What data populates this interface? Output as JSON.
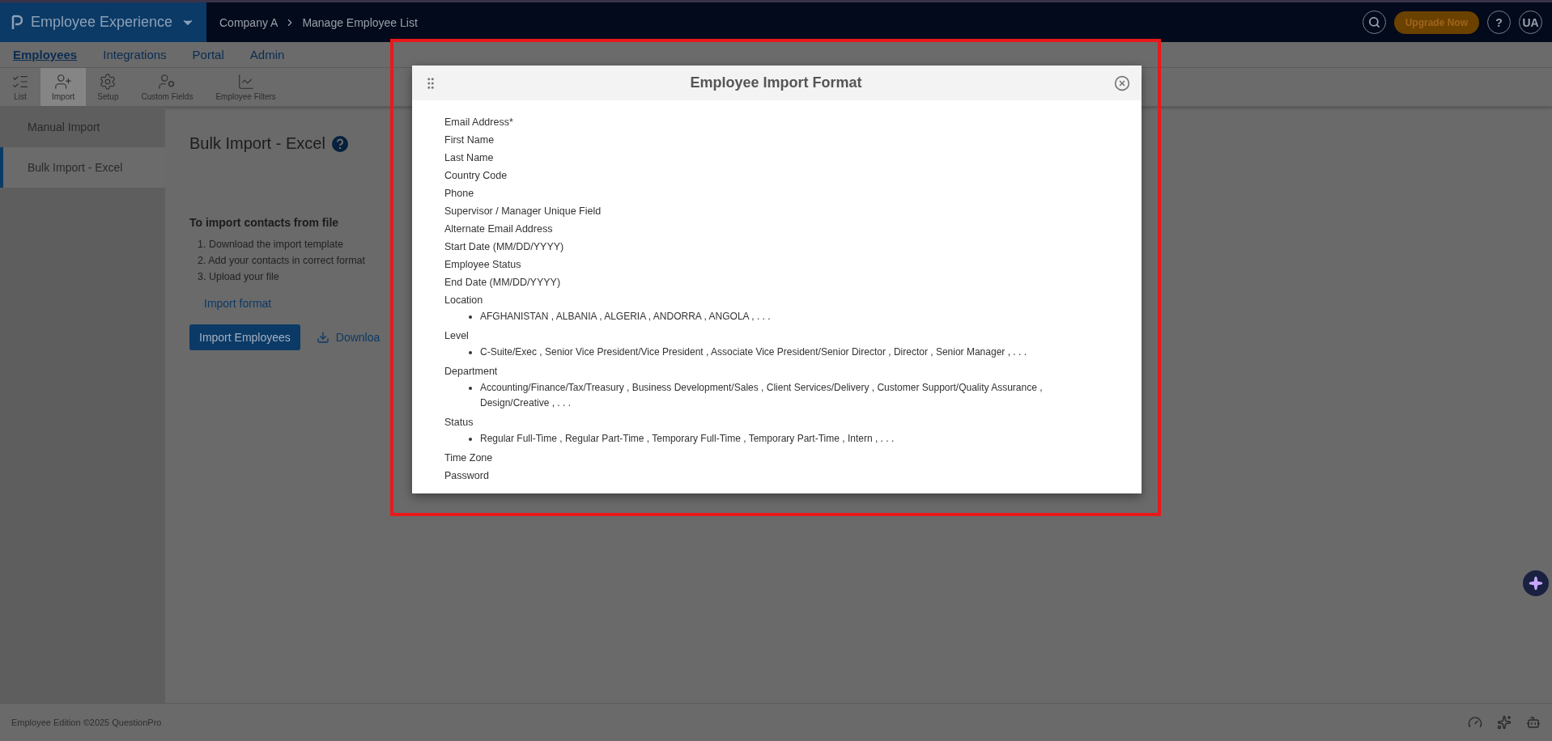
{
  "app": {
    "product": "Employee Experience",
    "breadcrumb": [
      "Company A",
      "Manage Employee List"
    ],
    "upgrade_button": "Upgrade Now",
    "help_button": "?",
    "avatar": "UA"
  },
  "nav_tabs": [
    {
      "label": "Employees",
      "selected": true
    },
    {
      "label": "Integrations",
      "selected": false
    },
    {
      "label": "Portal",
      "selected": false
    },
    {
      "label": "Admin",
      "selected": false
    }
  ],
  "toolbar": [
    {
      "label": "List",
      "kind": "list",
      "selected": false
    },
    {
      "label": "Import",
      "kind": "import",
      "selected": true
    },
    {
      "label": "Setup",
      "kind": "setup",
      "selected": false
    },
    {
      "label": "Custom Fields",
      "kind": "custom",
      "selected": false
    },
    {
      "label": "Employee Filters",
      "kind": "filters",
      "selected": false
    }
  ],
  "sidebar": {
    "items": [
      {
        "label": "Manual Import",
        "selected": false
      },
      {
        "label": "Bulk Import - Excel",
        "selected": true
      }
    ]
  },
  "main": {
    "title": "Bulk Import - Excel",
    "instructions_title": "To import contacts from file",
    "steps": [
      "1. Download the import template",
      "2. Add your contacts in correct format",
      "3. Upload your file"
    ],
    "format_link": "Import format",
    "import_button": "Import Employees",
    "download_link": "Downloa"
  },
  "modal": {
    "title": "Employee Import Format",
    "fields": [
      {
        "label": "Email Address*"
      },
      {
        "label": "First Name"
      },
      {
        "label": "Last Name"
      },
      {
        "label": "Country Code"
      },
      {
        "label": "Phone"
      },
      {
        "label": "Supervisor / Manager Unique Field"
      },
      {
        "label": "Alternate Email Address"
      },
      {
        "label": "Start Date (MM/DD/YYYY)"
      },
      {
        "label": "Employee Status"
      },
      {
        "label": "End Date (MM/DD/YYYY)"
      },
      {
        "label": "Location",
        "options": "AFGHANISTAN , ALBANIA , ALGERIA , ANDORRA , ANGOLA , . . ."
      },
      {
        "label": "Level",
        "options": "C-Suite/Exec , Senior Vice President/Vice President , Associate Vice President/Senior Director , Director , Senior Manager , . . ."
      },
      {
        "label": "Department",
        "options": "Accounting/Finance/Tax/Treasury , Business Development/Sales , Client Services/Delivery , Customer Support/Quality Assurance , Design/Creative , . . ."
      },
      {
        "label": "Status",
        "options": "Regular Full-Time , Regular Part-Time , Temporary Full-Time , Temporary Part-Time , Intern , . . ."
      },
      {
        "label": "Time Zone"
      },
      {
        "label": "Password"
      }
    ]
  },
  "footer": {
    "text": "Employee Edition ©2025 QuestionPro"
  }
}
